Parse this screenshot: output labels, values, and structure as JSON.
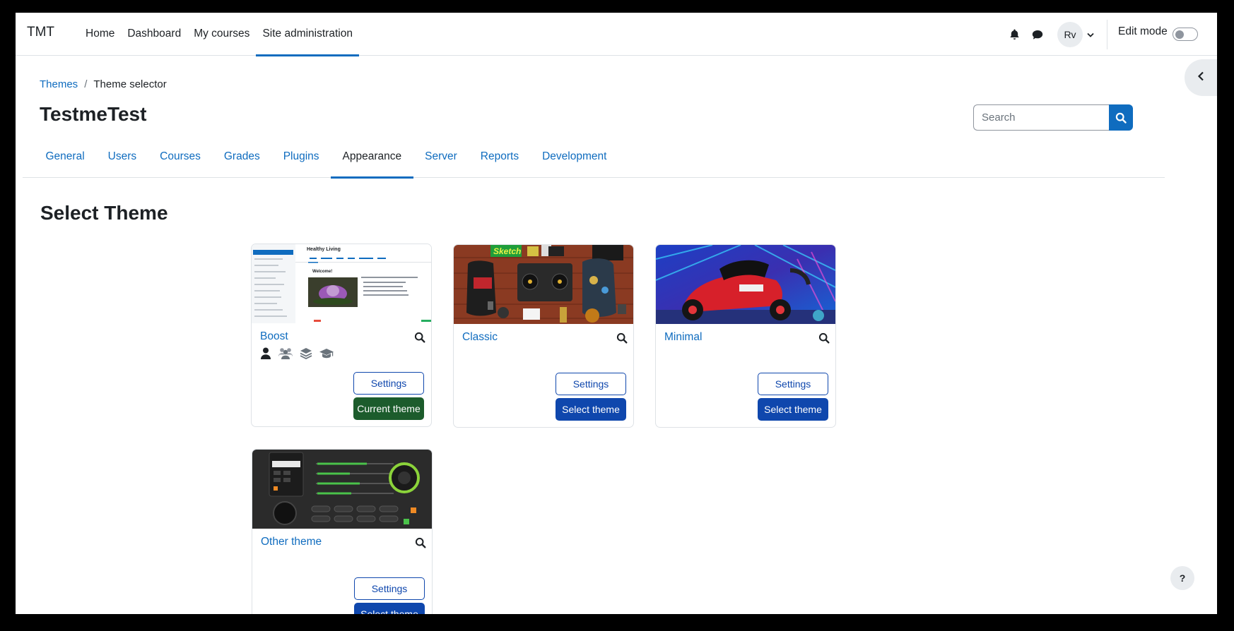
{
  "navbar": {
    "brand": "TMT",
    "links": [
      "Home",
      "Dashboard",
      "My courses",
      "Site administration"
    ],
    "active_link": "Site administration",
    "avatar_initials": "Rv",
    "edit_mode_label": "Edit mode",
    "edit_mode_on": false
  },
  "breadcrumb": {
    "parent": "Themes",
    "current": "Theme selector"
  },
  "page_title": "TestmeTest",
  "search": {
    "placeholder": "Search"
  },
  "secondary_nav": {
    "tabs": [
      "General",
      "Users",
      "Courses",
      "Grades",
      "Plugins",
      "Appearance",
      "Server",
      "Reports",
      "Development"
    ],
    "active_tab": "Appearance"
  },
  "section_title": "Select Theme",
  "themes": [
    {
      "name": "Boost",
      "settings_label": "Settings",
      "action_label": "Current theme",
      "is_current": true,
      "feature_icons": [
        "user-icon",
        "users-icon",
        "layers-icon",
        "graduation-cap-icon"
      ],
      "preview": {
        "course_title": "Healthy Living",
        "welcome": "Welcome!"
      }
    },
    {
      "name": "Classic",
      "settings_label": "Settings",
      "action_label": "Select theme",
      "is_current": false,
      "preview": {
        "sticker": "Sketch"
      }
    },
    {
      "name": "Minimal",
      "settings_label": "Settings",
      "action_label": "Select theme",
      "is_current": false
    },
    {
      "name": "Other theme",
      "settings_label": "Settings",
      "action_label": "Select theme",
      "is_current": false
    }
  ],
  "help_label": "?",
  "colors": {
    "link": "#0f6cbf",
    "primary_button": "#0f47ad",
    "current_theme_button": "#1c5c2c"
  }
}
